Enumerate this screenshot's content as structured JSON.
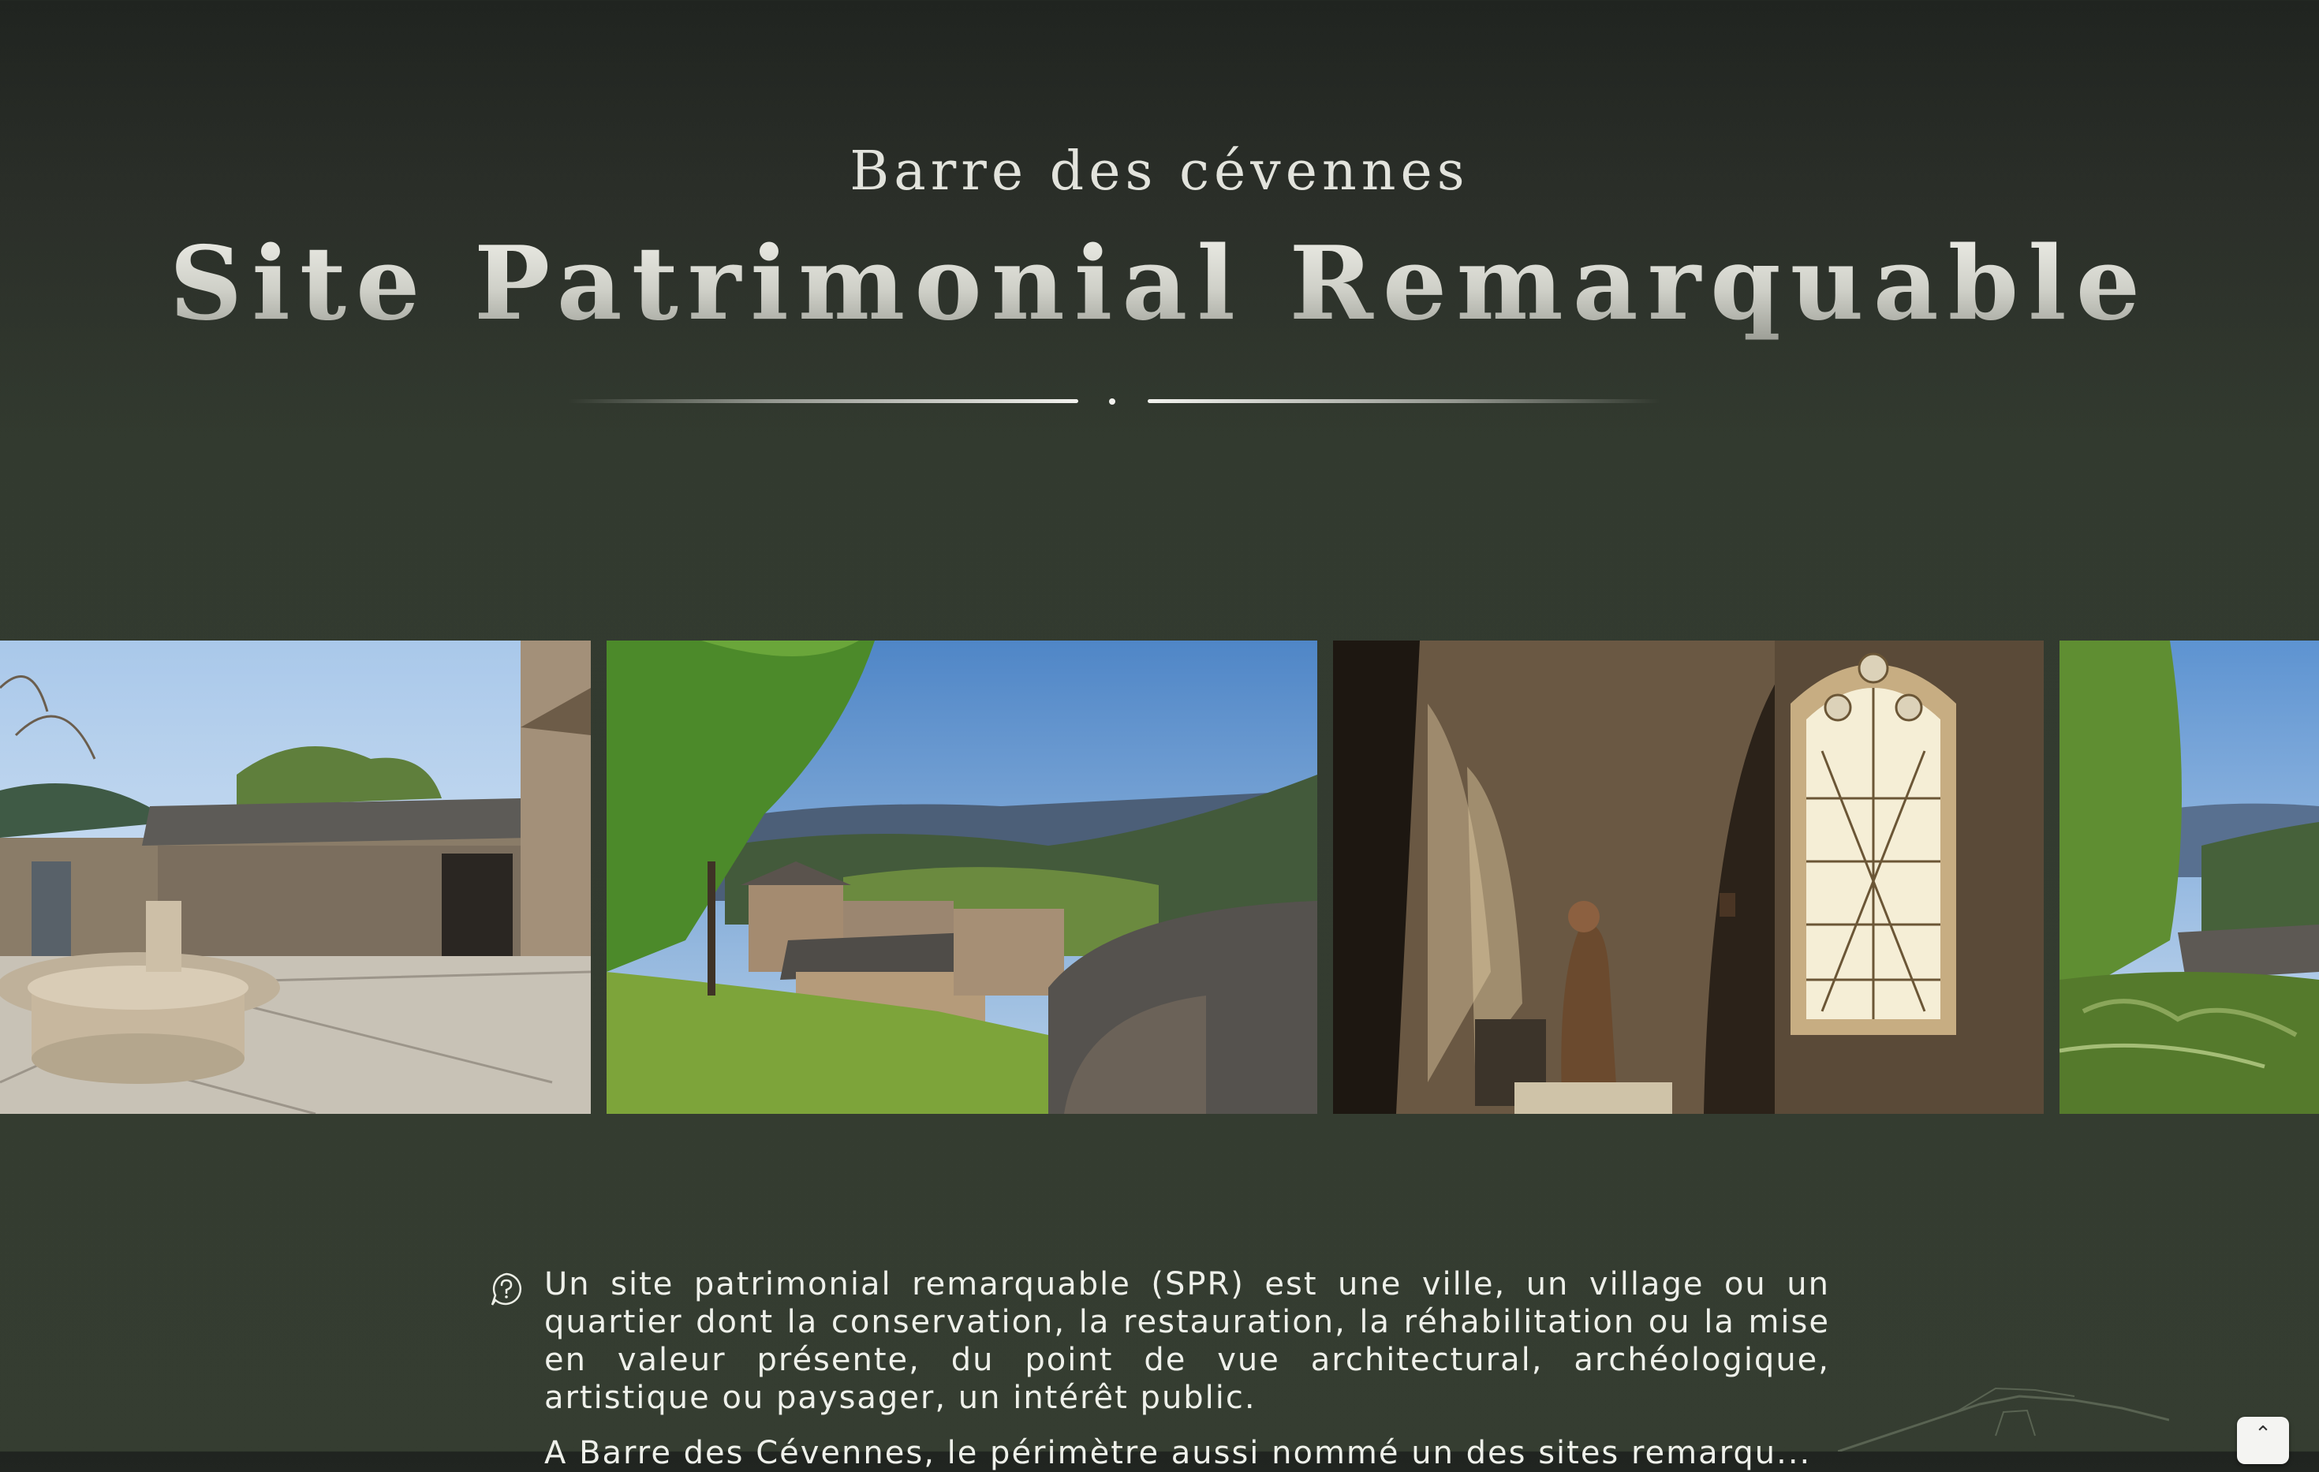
{
  "hero": {
    "kicker": "Barre des cévennes",
    "title": "Site Patrimonial Remarquable"
  },
  "gallery": {
    "photos": [
      {
        "name": "fountain-courtyard-photo"
      },
      {
        "name": "village-rooftops-valley-photo"
      },
      {
        "name": "church-interior-window-photo"
      },
      {
        "name": "hillside-view-photo"
      }
    ]
  },
  "info": {
    "icon": "question-bubble-icon",
    "paragraph": "Un site patrimonial remarquable (SPR) est une ville, un village ou un quartier dont la conservation, la restauration, la réhabilitation ou la mise en valeur présente, du point de vue architectural, archéologique, artistique ou paysager, un intérêt public.",
    "paragraph2_partial": "A Barre des Cévennes, le périmètre aussi nommé un des sites remarqu..."
  },
  "controls": {
    "back_to_top": "⌃"
  },
  "colors": {
    "background_top": "#202420",
    "background_bottom": "#353d31",
    "text": "#eceee6"
  }
}
